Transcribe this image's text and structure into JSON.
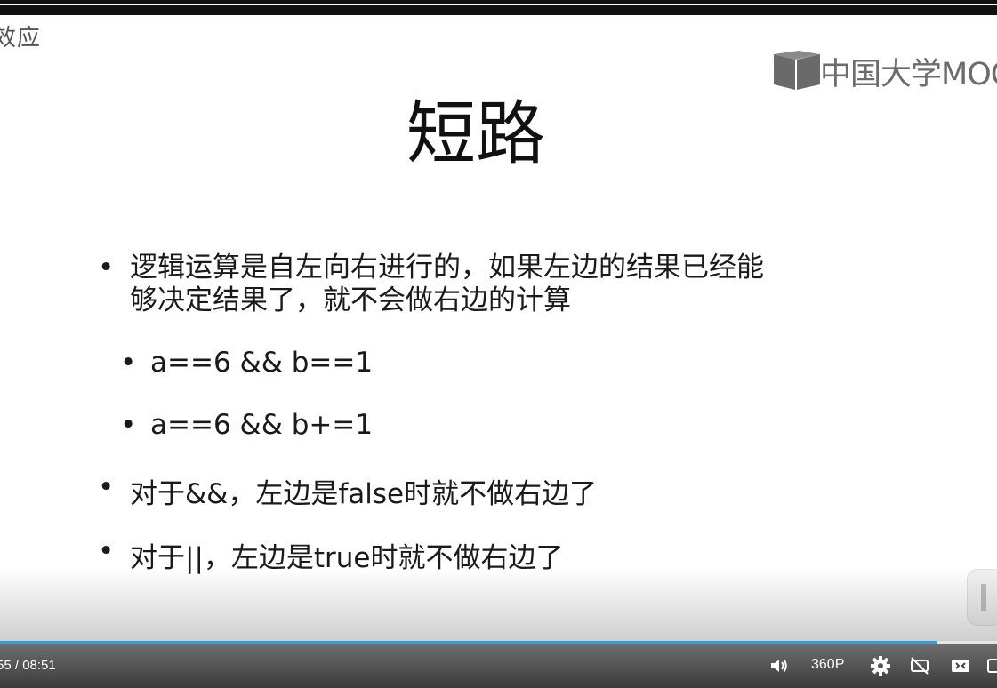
{
  "corner_label": "效应",
  "logo": {
    "text": "中国大学MOOC"
  },
  "slide": {
    "title": "短路",
    "bullets": [
      {
        "line1": "逻辑运算是自左向右进行的，如果左边的结果已经能",
        "line2": "够决定结果了，就不会做右边的计算"
      },
      {
        "text": "a==6 && b==1"
      },
      {
        "text": "a==6 && b+=1"
      },
      {
        "text": "对于&&，左边是false时就不做右边了"
      },
      {
        "text": "对于||，左边是true时就不做右边了"
      }
    ],
    "bullet_glyph": "•"
  },
  "player": {
    "time_current": "55",
    "time_separator": "/",
    "time_total": "08:51",
    "progress": 0.94,
    "quality": "360P",
    "accent_color": "#29a3e5"
  }
}
